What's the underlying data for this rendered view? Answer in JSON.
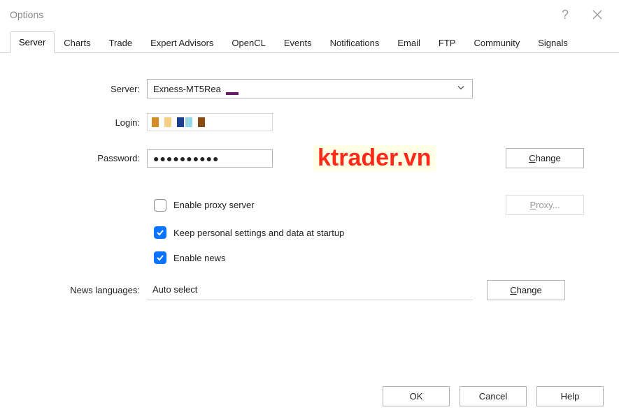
{
  "window": {
    "title": "Options"
  },
  "tabs": [
    {
      "id": "server",
      "label": "Server",
      "active": true
    },
    {
      "id": "charts",
      "label": "Charts",
      "active": false
    },
    {
      "id": "trade",
      "label": "Trade",
      "active": false
    },
    {
      "id": "ea",
      "label": "Expert Advisors",
      "active": false
    },
    {
      "id": "opencl",
      "label": "OpenCL",
      "active": false
    },
    {
      "id": "events",
      "label": "Events",
      "active": false
    },
    {
      "id": "notifications",
      "label": "Notifications",
      "active": false
    },
    {
      "id": "email",
      "label": "Email",
      "active": false
    },
    {
      "id": "ftp",
      "label": "FTP",
      "active": false
    },
    {
      "id": "community",
      "label": "Community",
      "active": false
    },
    {
      "id": "signals",
      "label": "Signals",
      "active": false
    }
  ],
  "labels": {
    "server": "Server:",
    "login": "Login:",
    "password": "Password:",
    "news_languages": "News languages:"
  },
  "fields": {
    "server_value": "Exness-MT5Rea",
    "password_mask": "●●●●●●●●●●",
    "news_lang_value": "Auto select"
  },
  "checkboxes": {
    "enable_proxy": {
      "label": "Enable proxy server",
      "checked": false
    },
    "keep_settings": {
      "label": "Keep personal settings and data at startup",
      "checked": true
    },
    "enable_news": {
      "label": "Enable news",
      "checked": true
    }
  },
  "buttons": {
    "change": "hange",
    "change_prefix": "C",
    "proxy": "roxy...",
    "proxy_prefix": "P",
    "ok": "OK",
    "cancel": "Cancel",
    "help": "Help"
  },
  "watermark": "ktrader.vn",
  "login_chips": [
    "#d58b26",
    "transparent",
    "#f4cf85",
    "transparent",
    "#1a3f8e",
    "#96d6e6",
    "transparent",
    "#8a4a13"
  ]
}
